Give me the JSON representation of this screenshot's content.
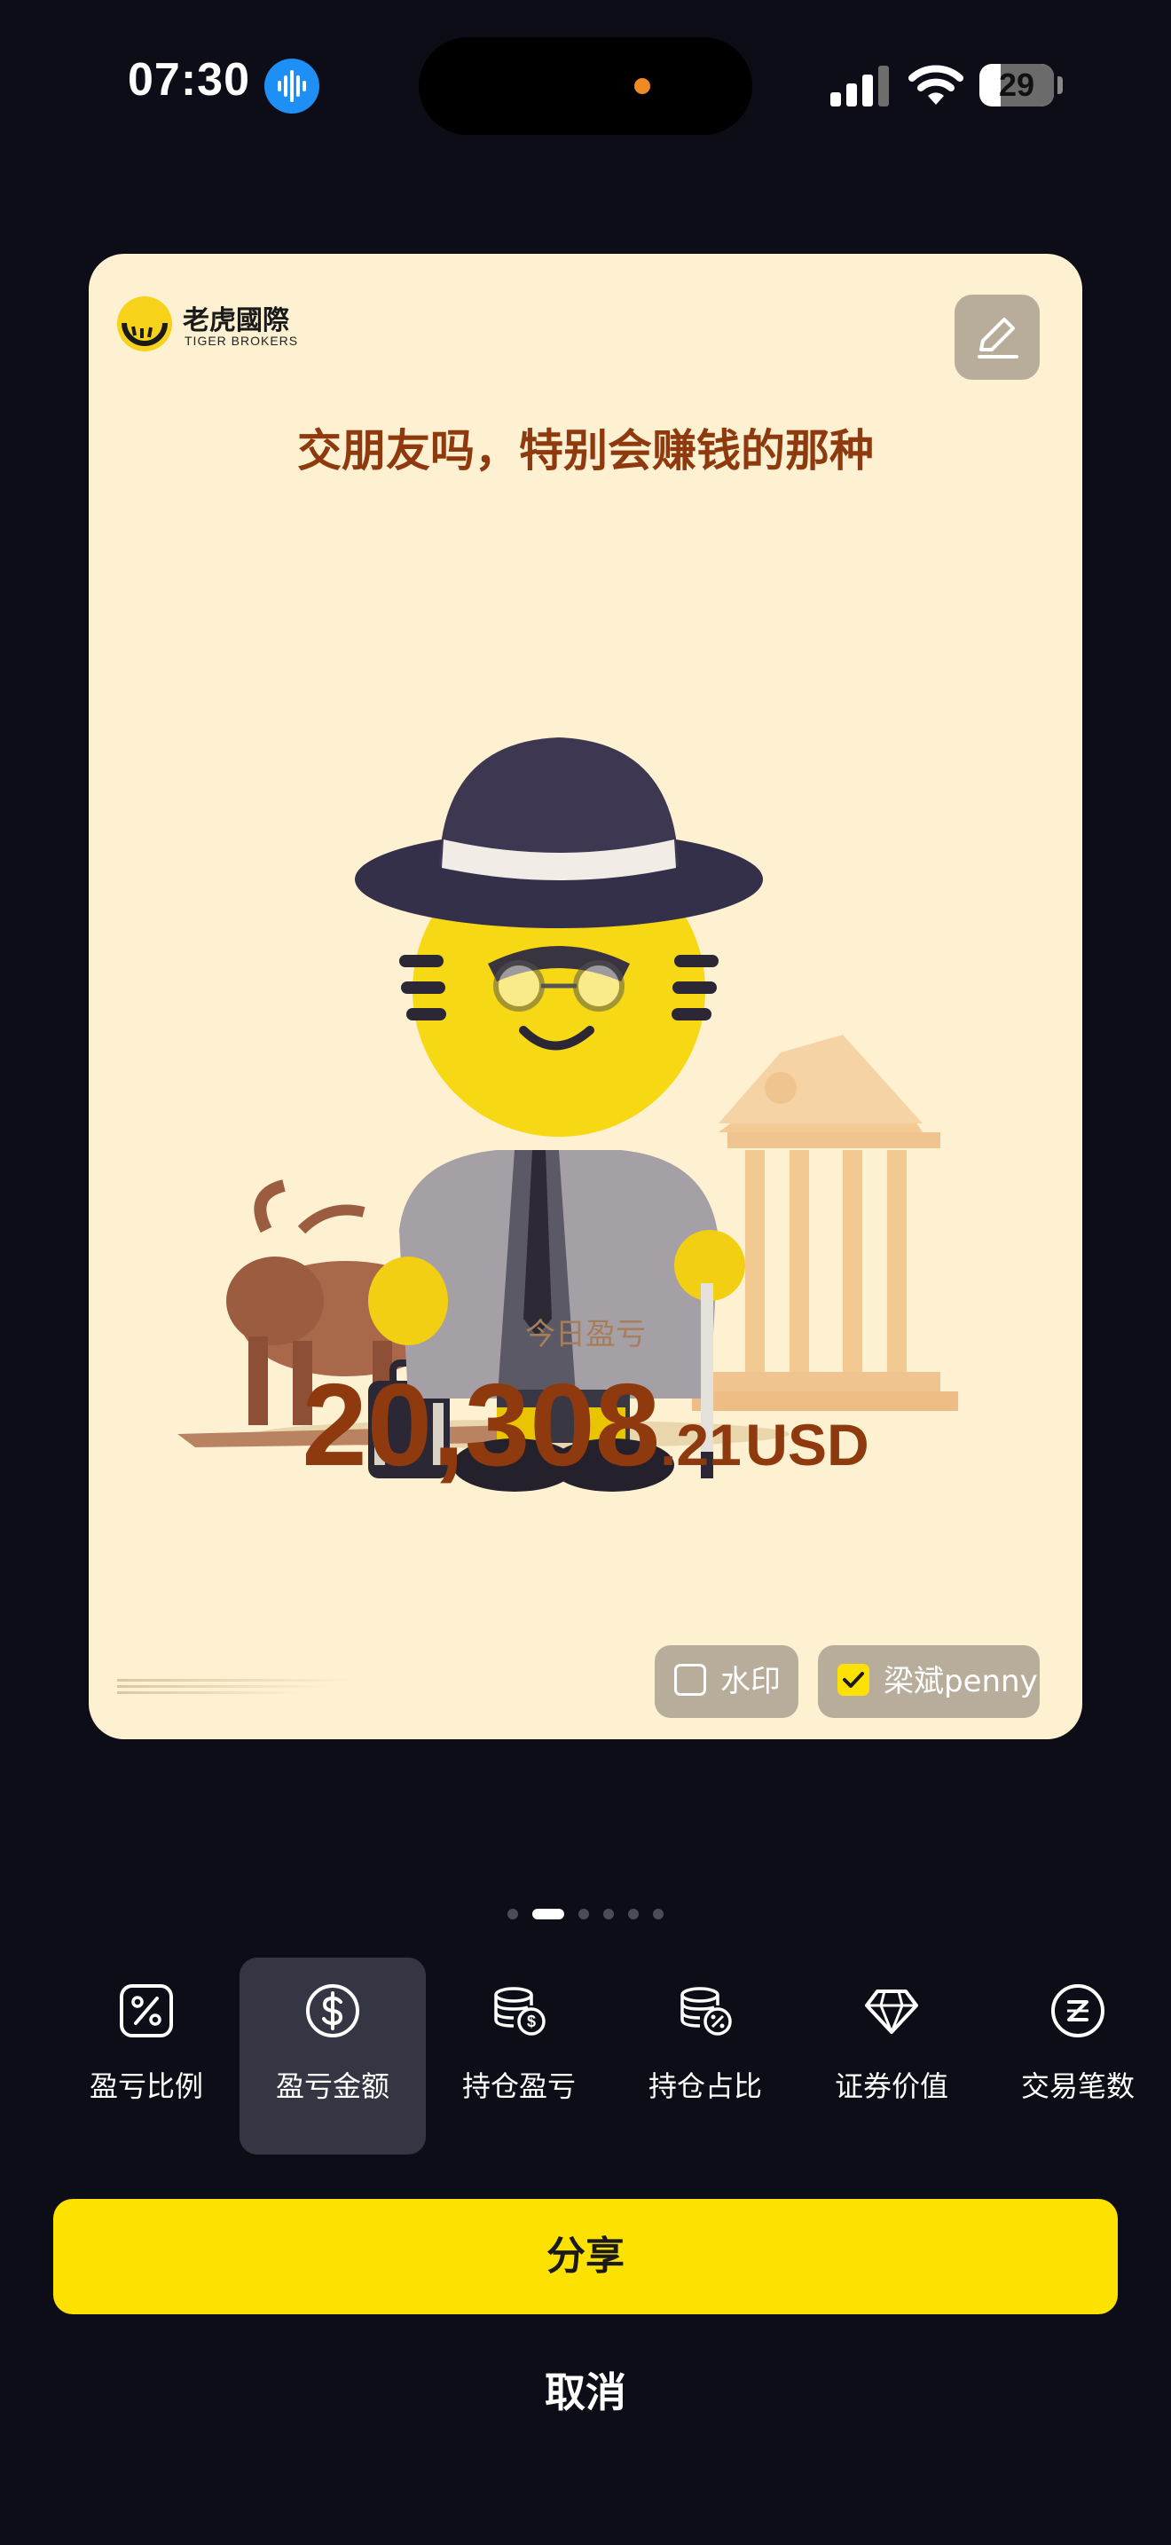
{
  "status_bar": {
    "time": "07:30",
    "battery": "29",
    "battery_level": 0.29,
    "icons": [
      "voice-memo-icon",
      "signal-icon",
      "wifi-icon",
      "battery-icon"
    ]
  },
  "card": {
    "brand_cn": "老虎國際",
    "brand_en": "TIGER BROKERS",
    "headline": "交朋友吗，特别会赚钱的那种",
    "pnl_label": "今日盈亏",
    "pnl_integer": "20,308",
    "pnl_decimal": ".21",
    "pnl_currency": "USD",
    "watermark_label": "水印",
    "watermark_checked": false,
    "name_label": "梁斌penny",
    "name_checked": true,
    "colors": {
      "background": "#fdf1d2",
      "accent": "#8f3a0e",
      "chip": "#b7ad9a"
    }
  },
  "pager": {
    "count": 6,
    "active_index": 1
  },
  "tabs": [
    {
      "label": "盈亏比例",
      "icon": "percent-icon",
      "selected": false
    },
    {
      "label": "盈亏金额",
      "icon": "dollar-icon",
      "selected": true
    },
    {
      "label": "持仓盈亏",
      "icon": "coins-dollar-icon",
      "selected": false
    },
    {
      "label": "持仓占比",
      "icon": "coins-percent-icon",
      "selected": false
    },
    {
      "label": "证券价值",
      "icon": "diamond-icon",
      "selected": false
    },
    {
      "label": "交易笔数",
      "icon": "z-circle-icon",
      "selected": false
    }
  ],
  "actions": {
    "share_label": "分享",
    "cancel_label": "取消",
    "share_color": "#fde100"
  }
}
